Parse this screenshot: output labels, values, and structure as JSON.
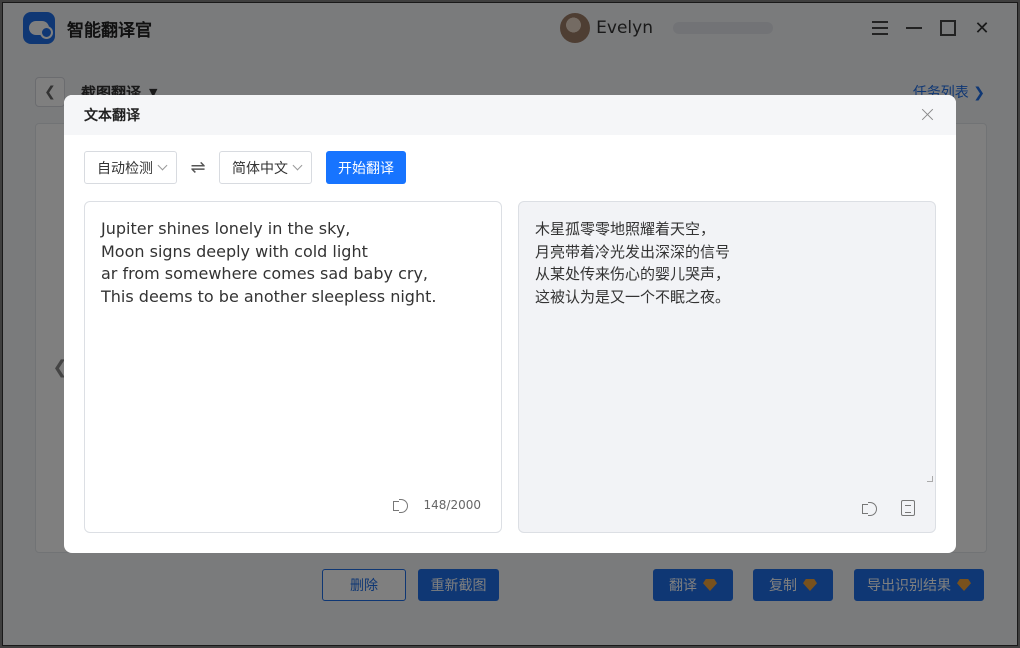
{
  "app": {
    "title": "智能翻译官",
    "username": "Evelyn",
    "breadcrumb": "截图翻译",
    "task_list_link": "任务列表",
    "buttons": {
      "delete": "删除",
      "recapture": "重新截图",
      "translate": "翻译",
      "copy": "复制",
      "export": "导出识别结果"
    }
  },
  "modal": {
    "title": "文本翻译",
    "source_language": "自动检测",
    "target_language": "简体中文",
    "start_button": "开始翻译",
    "source_lines": [
      "Jupiter shines lonely in the sky,",
      "Moon signs deeply with cold light",
      "ar from somewhere comes sad baby cry,",
      "This deems to be another sleepless night."
    ],
    "char_count": "148/2000",
    "target_lines": [
      "木星孤零零地照耀着天空，",
      "月亮带着冷光发出深深的信号",
      "从某处传来伤心的婴儿哭声，",
      "这被认为是又一个不眠之夜。"
    ]
  },
  "colors": {
    "accent": "#1774ff",
    "overlay": "rgba(0,0,0,0.5)",
    "vip_badge": "#f1a23a"
  }
}
